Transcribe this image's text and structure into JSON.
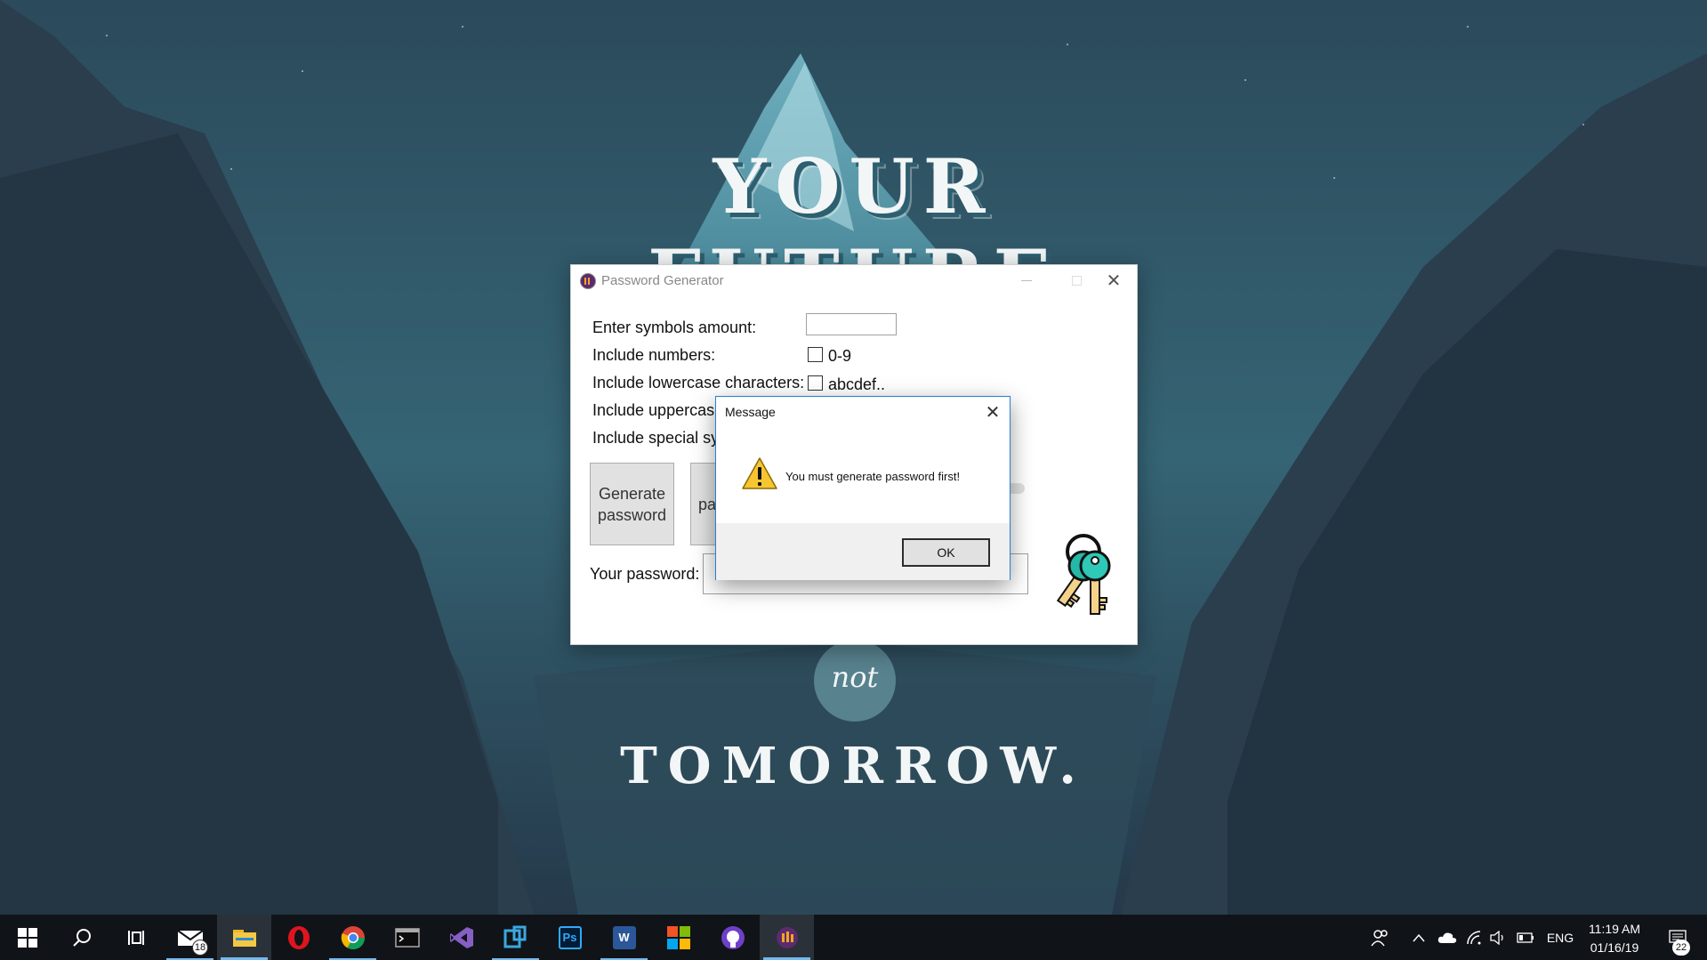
{
  "wallpaper": {
    "line1": "YOUR",
    "line2": "FUTURE",
    "line3": "not",
    "line4": "TOMORROW."
  },
  "main_window": {
    "title": "Password Generator",
    "labels": {
      "symbols_amount": "Enter symbols amount:",
      "include_numbers": "Include numbers:",
      "include_lowercase": "Include lowercase characters:",
      "include_uppercase": "Include uppercase",
      "include_special": "Include special syr"
    },
    "symbols_amount_value": "",
    "numbers_checkbox": {
      "label": "0-9",
      "checked": false
    },
    "lowercase_checkbox": {
      "label": "abcdef..",
      "checked": false
    },
    "generate_button": "Generate password",
    "second_button_visible": "pa",
    "your_password_label": "Your password:",
    "password_value": ""
  },
  "message_dialog": {
    "title": "Message",
    "icon": "warning-icon",
    "text": "You must generate password first!",
    "ok_label": "OK"
  },
  "taskbar": {
    "apps": [
      {
        "name": "start",
        "icon": "windows-icon"
      },
      {
        "name": "search",
        "icon": "search-icon"
      },
      {
        "name": "task-view",
        "icon": "task-view-icon"
      },
      {
        "name": "mail",
        "icon": "mail-icon",
        "badge": "18"
      },
      {
        "name": "file-explorer",
        "icon": "folder-icon"
      },
      {
        "name": "opera",
        "icon": "opera-icon"
      },
      {
        "name": "chrome",
        "icon": "chrome-icon"
      },
      {
        "name": "terminal",
        "icon": "terminal-icon"
      },
      {
        "name": "visual-studio",
        "icon": "visual-studio-icon"
      },
      {
        "name": "azure-data-studio",
        "icon": "data-studio-icon"
      },
      {
        "name": "photoshop",
        "icon": "photoshop-icon",
        "label": "Ps"
      },
      {
        "name": "word",
        "icon": "word-icon",
        "label": "W"
      },
      {
        "name": "windows-apps",
        "icon": "color-squares-icon"
      },
      {
        "name": "github",
        "icon": "github-icon"
      },
      {
        "name": "password-generator",
        "icon": "password-generator-icon"
      }
    ],
    "tray": {
      "language": "ENG",
      "time": "11:19 AM",
      "date": "01/16/19",
      "notifications": "22"
    },
    "accent_color": "#76b9ed"
  }
}
